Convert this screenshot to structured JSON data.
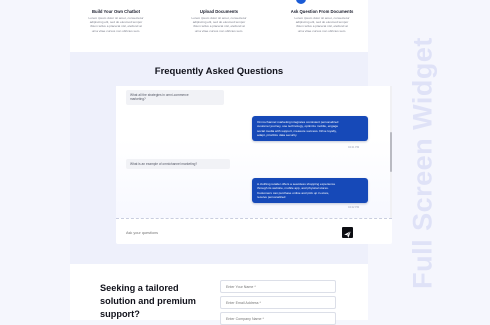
{
  "features": [
    {
      "title": "Build Your Own Chatbot",
      "desc": "Lorem ipsum dolor sit amet, consectetur\nadipiscing elit, sed do eiusmod tempor\nibtum tellus a placerat nisl, eleifend at\nurna vitae cursus non ultricies sem."
    },
    {
      "title": "Upload Documents",
      "desc": "Lorem ipsum dolor sit amet, consectetur\nadipiscing elit, sed do eiusmod tempor\nibtum tellus a placerat nisl, eleifend at\nurna vitae cursus non ultricies sem."
    },
    {
      "title": "Ask Question From Documents",
      "desc": "Lorem ipsum dolor sit amet, consectetur\nadipiscing elit, sed do eiusmod tempor\nibtum tellus a placerat nisl, eleifend at\nurna vitae cursus non ultricies sem."
    }
  ],
  "faq": {
    "title": "Frequently Asked Questions",
    "messages": [
      {
        "role": "user",
        "text": "What all the strategies in omni-commerce\nmarketing?"
      },
      {
        "role": "bot",
        "text": "Omni-channel marketing integrates consistent personalized\ncustomer journey, use technology, optimize mobile, engage\nsocial media with support, measure success. Drive loyalty,\nadapt, prioritize data security.",
        "meta": "04:21 PM"
      },
      {
        "role": "user",
        "text": "What is an example of omnichannel marketing?"
      },
      {
        "role": "bot",
        "text": "A clothing retailer offers a seamless shopping experience\nthrough its website, mobile app, and physical stores.\nCustomers can purchase online and pick up in-store,\nreceive personalized",
        "meta": "04:22 PM"
      }
    ],
    "input_placeholder": "Ask your questions"
  },
  "contact": {
    "title": "Seeking a tailored\nsolution and premium\nsupport?",
    "fields": [
      {
        "placeholder": "Enter Your Name *"
      },
      {
        "placeholder": "Enter Email Address *"
      },
      {
        "placeholder": "Enter Company Name *"
      }
    ]
  },
  "side_title": "Full Screen Widget",
  "colors": {
    "accent": "#1649b8",
    "page_bg": "#f5f6fd",
    "section_bg": "#eef0fb",
    "watermark": "#dfe2f7"
  },
  "icons": {
    "send": "paper-plane-icon"
  }
}
